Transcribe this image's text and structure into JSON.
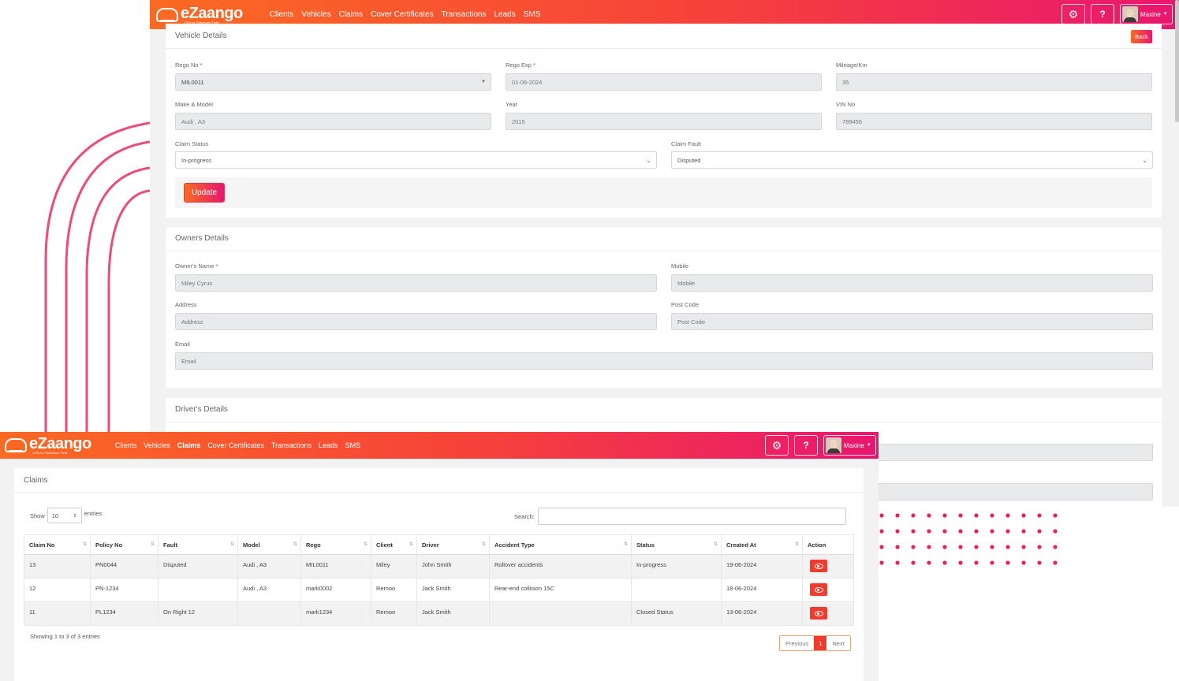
{
  "brand": {
    "name": "eZaango",
    "tagline": "CRM for Rideshare Fleet"
  },
  "nav": [
    "Clients",
    "Vehicles",
    "Claims",
    "Cover Certificates",
    "Transactions",
    "Leads",
    "SMS"
  ],
  "user": {
    "name": "Maxine"
  },
  "colors": {
    "brand_start": "#fb6a22",
    "brand_end": "#e9166f",
    "danger": "#f23a2d"
  },
  "vehicle": {
    "title": "Vehicle Details",
    "back_label": "Back",
    "rego_no_label": "Rego No",
    "rego_no": "MIL0011",
    "rego_exp_label": "Rego Exp",
    "rego_exp": "01-06-2024",
    "mileage_label": "Mileage/Km",
    "mileage": "35",
    "make_model_label": "Make & Model",
    "make_model": "Audi , A3",
    "year_label": "Year",
    "year": "2015",
    "vin_label": "VIN No",
    "vin": "789456",
    "claim_status_label": "Claim Status",
    "claim_status": "In-progress",
    "claim_fault_label": "Claim Fault",
    "claim_fault": "Disputed",
    "update_label": "Update"
  },
  "owner": {
    "title": "Owners Details",
    "name_label": "Owner's Name",
    "name": "Miley Cyrus",
    "mobile_label": "Mobile",
    "mobile_placeholder": "Mobile",
    "address_label": "Address",
    "address_placeholder": "Address",
    "postcode_label": "Post Code",
    "postcode_placeholder": "Post Code",
    "email_label": "Email",
    "email_placeholder": "Email"
  },
  "driver": {
    "title": "Driver's Details"
  },
  "claims": {
    "title": "Claims",
    "show_label": "Show",
    "entries_label": "entries",
    "page_size": "10",
    "search_label": "Search:",
    "columns": [
      "Claim No",
      "Policy No",
      "Fault",
      "Model",
      "Rego",
      "Client",
      "Driver",
      "Accident Type",
      "Status",
      "Created At",
      "Action"
    ],
    "rows": [
      {
        "claim_no": "13",
        "policy_no": "PN0044",
        "fault": "Disputed",
        "model": "Audi , A3",
        "rego": "MIL0011",
        "client": "Miley",
        "driver": "John Smith",
        "accident_type": "Rollover accidents",
        "status": "In-progress",
        "created_at": "19-06-2024"
      },
      {
        "claim_no": "12",
        "policy_no": "PN-1234",
        "fault": "",
        "model": "Audi , A3",
        "rego": "mark0002",
        "client": "Remoo",
        "driver": "Jack Smith",
        "accident_type": "Rear-end collision 15C",
        "status": "",
        "created_at": "18-06-2024"
      },
      {
        "claim_no": "11",
        "policy_no": "PL1234",
        "fault": "On Right 12",
        "model": "",
        "rego": "mark1234",
        "client": "Remoo",
        "driver": "Jack Smith",
        "accident_type": "",
        "status": "Closed Status",
        "created_at": "13-06-2024"
      }
    ],
    "info": "Showing 1 to 3 of 3 entries",
    "prev_label": "Previous",
    "current_page": "1",
    "next_label": "Next"
  }
}
